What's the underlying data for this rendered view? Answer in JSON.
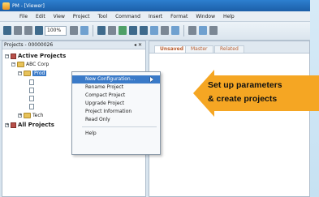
{
  "window": {
    "title": "PM - [Viewer]"
  },
  "menu": {
    "items": [
      "File",
      "Edit",
      "View",
      "Project",
      "Tool",
      "Command",
      "Insert",
      "Format",
      "Window",
      "Help"
    ]
  },
  "toolbar": {
    "zoom": "100%"
  },
  "left_panel": {
    "header": "Projects - 00000026",
    "tree": {
      "active_projects": "Active Projects",
      "abc_corp": "ABC Corp",
      "selected_item": "Prod",
      "tech": "Tech",
      "all_projects": "All Projects"
    }
  },
  "right_panel": {
    "tabs": [
      "Unsaved",
      "Master",
      "Related"
    ]
  },
  "context_menu": {
    "items": [
      "New Configuration...",
      "Rename Project",
      "Compact Project",
      "Upgrade Project",
      "Project Information",
      "Read Only"
    ],
    "help": "Help"
  },
  "callout": {
    "line1": "Set up parameters",
    "line2": "& create projects",
    "color": "#f5a623"
  }
}
